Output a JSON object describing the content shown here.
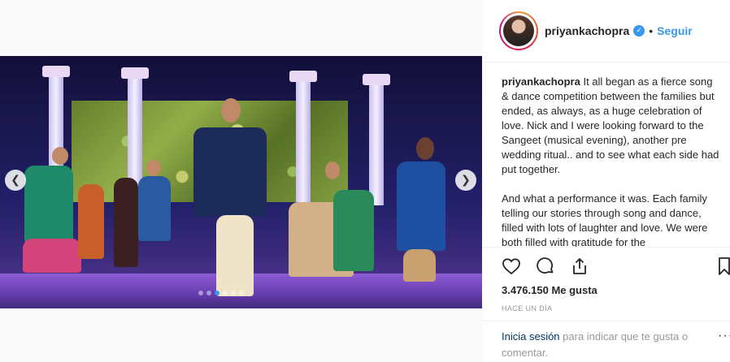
{
  "post": {
    "username": "priyankachopra",
    "follow_label": "Seguir",
    "separator": "•",
    "caption_user": "priyankachopra",
    "caption_p1": "It all began as a fierce song & dance competition between the families but ended, as always, as a huge celebration of love.  Nick and I were looking forward to the Sangeet (musical evening), another pre wedding ritual.. and to see what each side had put together.",
    "caption_p2": "And what a performance it was. Each family telling our stories through song and dance, filled with lots of laughter and love. We were both filled with gratitude for the",
    "likes": "3.476.150 Me gusta",
    "time": "HACE UN DÍA",
    "login_link": "Inicia sesión",
    "login_rest": " para indicar que te gusta o comentar.",
    "more": "···"
  },
  "carousel": {
    "dot_count": 6,
    "active_index": 2,
    "accent": "#3897f0"
  },
  "icons": {
    "verified": "verified-badge",
    "like": "heart-icon",
    "comment": "comment-icon",
    "share": "share-icon",
    "save": "bookmark-icon"
  }
}
